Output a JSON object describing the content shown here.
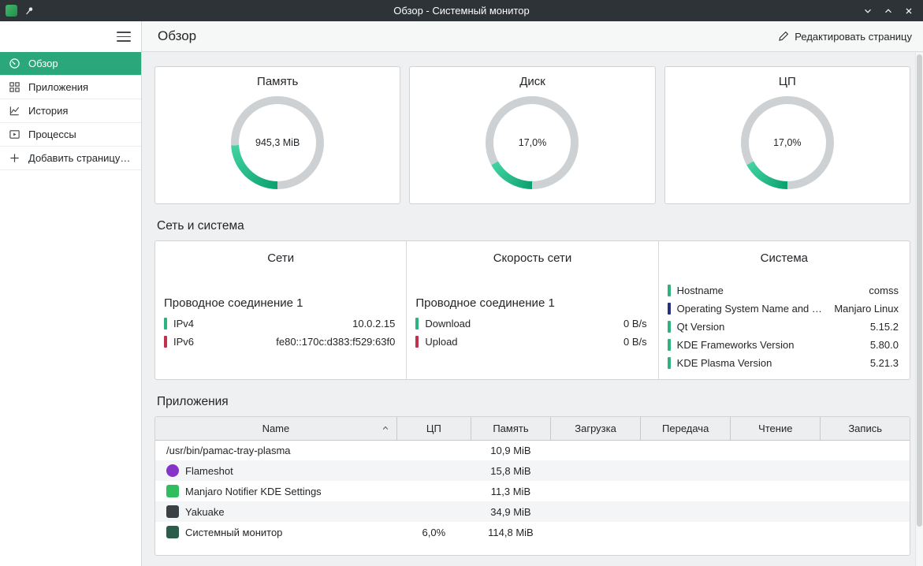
{
  "theme": {
    "accent": "#2aa87c",
    "titlebar_bg": "#2e3338",
    "gauge_track": "#cdd1d3",
    "gauge_arc_start": "#0ca06f",
    "gauge_arc_end": "#43d3a2"
  },
  "titlebar": {
    "title": "Обзор - Системный монитор"
  },
  "sidebar": {
    "items": [
      {
        "label": "Обзор"
      },
      {
        "label": "Приложения"
      },
      {
        "label": "История"
      },
      {
        "label": "Процессы"
      },
      {
        "label": "Добавить страницу…"
      }
    ]
  },
  "header": {
    "title": "Обзор",
    "edit_label": "Редактировать страницу"
  },
  "gauges": [
    {
      "title": "Память",
      "value_label": "945,3 MiB",
      "percent": 24
    },
    {
      "title": "Диск",
      "value_label": "17,0%",
      "percent": 17
    },
    {
      "title": "ЦП",
      "value_label": "17,0%",
      "percent": 17
    }
  ],
  "network_section": {
    "title": "Сеть и система",
    "columns": [
      {
        "title": "Сети",
        "subtitle": "Проводное соединение 1",
        "rows": [
          {
            "label": "IPv4",
            "value": "10.0.2.15",
            "color": "#2db47e"
          },
          {
            "label": "IPv6",
            "value": "fe80::170c:d383:f529:63f0",
            "color": "#c0314f"
          }
        ]
      },
      {
        "title": "Скорость сети",
        "subtitle": "Проводное соединение 1",
        "rows": [
          {
            "label": "Download",
            "value": "0 B/s",
            "color": "#2db47e"
          },
          {
            "label": "Upload",
            "value": "0 B/s",
            "color": "#c0314f"
          }
        ]
      },
      {
        "title": "Система",
        "rows": [
          {
            "label": "Hostname",
            "value": "comss",
            "color": "#2db47e"
          },
          {
            "label": "Operating System Name and Ve…",
            "value": "Manjaro Linux",
            "color": "#25317e"
          },
          {
            "label": "Qt Version",
            "value": "5.15.2",
            "color": "#2db47e"
          },
          {
            "label": "KDE Frameworks Version",
            "value": "5.80.0",
            "color": "#2db47e"
          },
          {
            "label": "KDE Plasma Version",
            "value": "5.21.3",
            "color": "#2db47e"
          }
        ]
      }
    ]
  },
  "apps_section": {
    "title": "Приложения",
    "table": {
      "columns": [
        "Name",
        "ЦП",
        "Память",
        "Загрузка",
        "Передача",
        "Чтение",
        "Запись"
      ],
      "sort_column": "Name",
      "rows": [
        {
          "name": "/usr/bin/pamac-tray-plasma",
          "cells": [
            "",
            "10,9 MiB",
            "",
            "",
            "",
            ""
          ]
        },
        {
          "name": "Flameshot",
          "icon_color": "#8633c9",
          "cells": [
            "",
            "15,8 MiB",
            "",
            "",
            "",
            ""
          ]
        },
        {
          "name": "Manjaro Notifier KDE Settings",
          "icon_color": "#2fbd5f",
          "cells": [
            "",
            "11,3 MiB",
            "",
            "",
            "",
            ""
          ]
        },
        {
          "name": "Yakuake",
          "icon_color": "#3a4045",
          "cells": [
            "",
            "34,9 MiB",
            "",
            "",
            "",
            ""
          ]
        },
        {
          "name": "Системный монитор",
          "icon_color": "#2c5d4c",
          "cells": [
            "6,0%",
            "114,8 MiB",
            "",
            "",
            "",
            ""
          ]
        }
      ]
    }
  }
}
